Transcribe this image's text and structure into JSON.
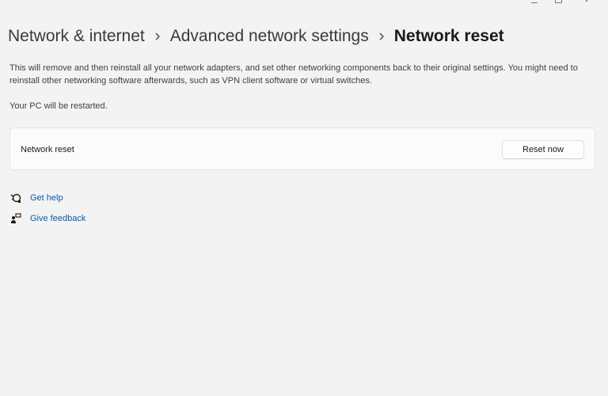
{
  "window": {
    "controls": [
      "minimize-icon",
      "maximize-icon",
      "close-icon"
    ]
  },
  "breadcrumb": {
    "items": [
      {
        "label": "Network & internet"
      },
      {
        "label": "Advanced network settings"
      },
      {
        "label": "Network reset"
      }
    ],
    "separator_icon": "chevron-right-icon"
  },
  "page": {
    "description": "This will remove and then reinstall all your network adapters, and set other networking components back to their original settings. You might need to reinstall other networking software afterwards, such as VPN client software or virtual switches.",
    "restart_note": "Your PC will be restarted."
  },
  "reset_card": {
    "label": "Network reset",
    "button_label": "Reset now"
  },
  "links": {
    "get_help": {
      "label": "Get help",
      "icon": "help-icon"
    },
    "give_feedback": {
      "label": "Give feedback",
      "icon": "feedback-icon"
    }
  },
  "colors": {
    "background": "#f3f3f3",
    "card": "#fbfbfb",
    "link": "#0a5aab"
  }
}
